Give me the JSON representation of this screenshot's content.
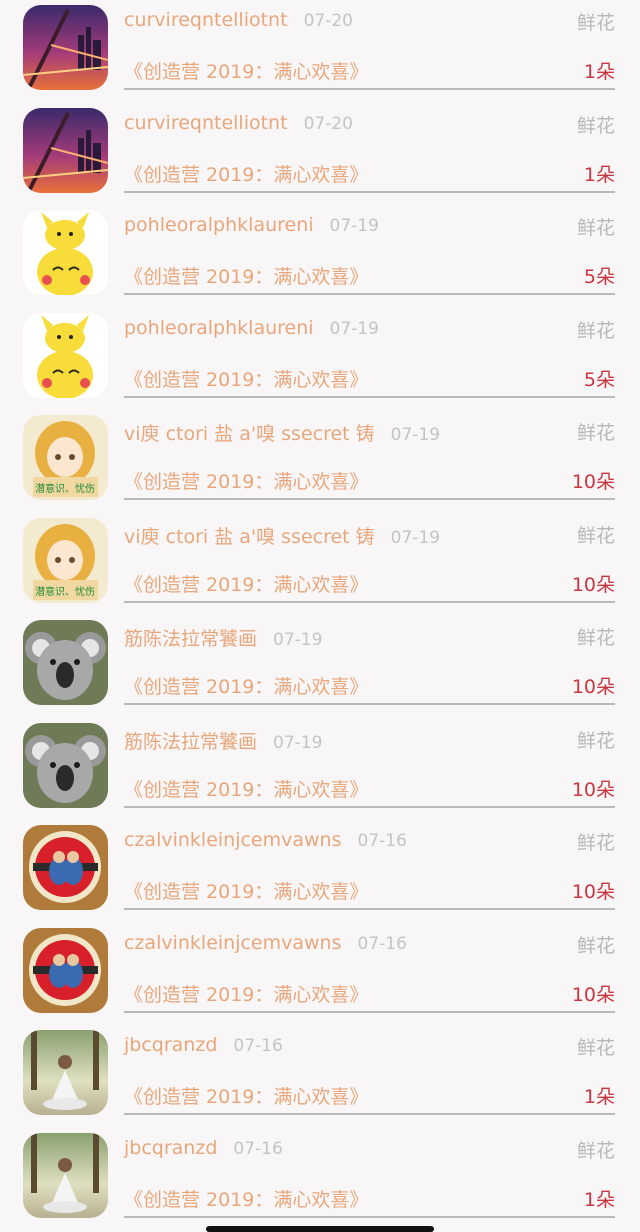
{
  "gift_records": [
    {
      "avatar_icon": "city-bridge-avatar",
      "name": "curvireqntelliotnt",
      "date": "07-20",
      "gift_type": "鲜花",
      "title": "《创造营 2019：满心欢喜》",
      "count": "1朵"
    },
    {
      "avatar_icon": "city-bridge-avatar",
      "name": "curvireqntelliotnt",
      "date": "07-20",
      "gift_type": "鲜花",
      "title": "《创造营 2019：满心欢喜》",
      "count": "1朵"
    },
    {
      "avatar_icon": "pikachu-avatar",
      "name": "pohleoralphklaureni",
      "date": "07-19",
      "gift_type": "鲜花",
      "title": "《创造营 2019：满心欢喜》",
      "count": "5朵"
    },
    {
      "avatar_icon": "pikachu-avatar",
      "name": "pohleoralphklaureni",
      "date": "07-19",
      "gift_type": "鲜花",
      "title": "《创造营 2019：满心欢喜》",
      "count": "5朵"
    },
    {
      "avatar_icon": "anime-girl-avatar",
      "name": "vi庾 ctori 盐 a'嗅 ssecret 铸",
      "date": "07-19",
      "gift_type": "鲜花",
      "title": "《创造营 2019：满心欢喜》",
      "count": "10朵",
      "avatar_text": "潜意识、忧伤"
    },
    {
      "avatar_icon": "anime-girl-avatar",
      "name": "vi庾 ctori 盐 a'嗅 ssecret 铸",
      "date": "07-19",
      "gift_type": "鲜花",
      "title": "《创造营 2019：满心欢喜》",
      "count": "10朵",
      "avatar_text": "潜意识、忧伤"
    },
    {
      "avatar_icon": "koala-avatar",
      "name": "筋陈法拉常饕画",
      "date": "07-19",
      "gift_type": "鲜花",
      "title": "《创造营 2019：满心欢喜》",
      "count": "10朵"
    },
    {
      "avatar_icon": "koala-avatar",
      "name": "筋陈法拉常饕画",
      "date": "07-19",
      "gift_type": "鲜花",
      "title": "《创造营 2019：满心欢喜》",
      "count": "10朵"
    },
    {
      "avatar_icon": "emblem-avatar",
      "name": "czalvinkleinjcemvawns",
      "date": "07-16",
      "gift_type": "鲜花",
      "title": "《创造营 2019：满心欢喜》",
      "count": "10朵"
    },
    {
      "avatar_icon": "emblem-avatar",
      "name": "czalvinkleinjcemvawns",
      "date": "07-16",
      "gift_type": "鲜花",
      "title": "《创造营 2019：满心欢喜》",
      "count": "10朵"
    },
    {
      "avatar_icon": "meditation-avatar",
      "name": "jbcqranzd",
      "date": "07-16",
      "gift_type": "鲜花",
      "title": "《创造营 2019：满心欢喜》",
      "count": "1朵"
    },
    {
      "avatar_icon": "meditation-avatar",
      "name": "jbcqranzd",
      "date": "07-16",
      "gift_type": "鲜花",
      "title": "《创造营 2019：满心欢喜》",
      "count": "1朵"
    }
  ],
  "colors": {
    "accent": "#e8a77a",
    "count_red": "#c8373f",
    "muted": "#b8b8b8",
    "background": "#f9f6f8"
  }
}
